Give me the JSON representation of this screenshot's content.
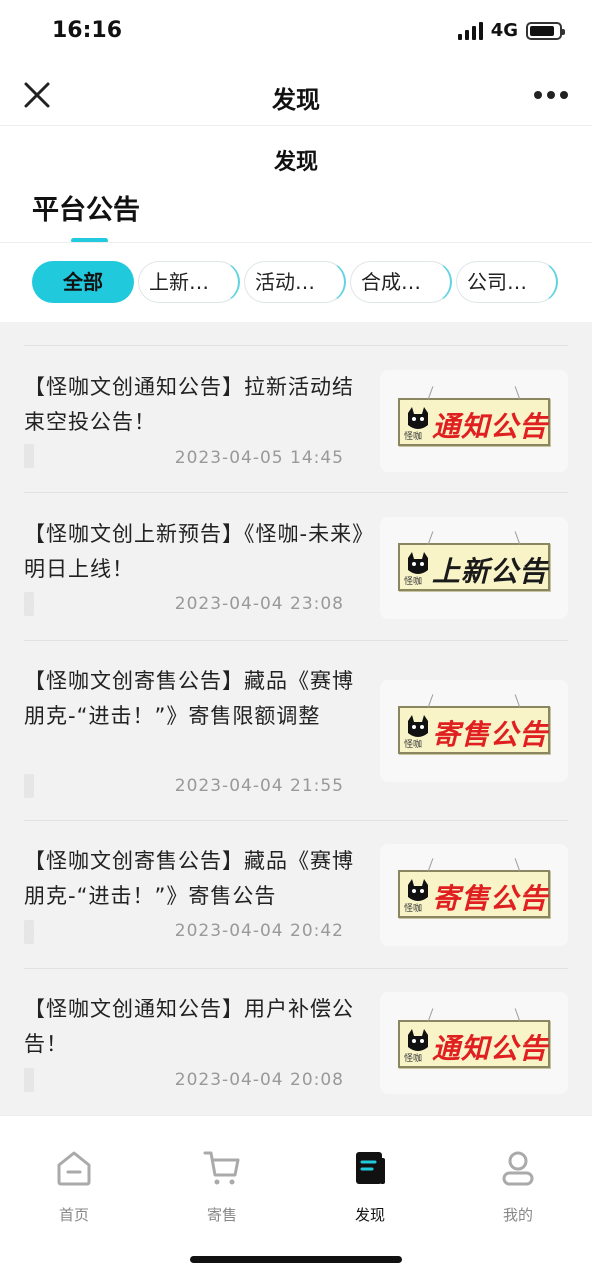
{
  "status_bar": {
    "time": "16:16",
    "network": "4G"
  },
  "nav": {
    "title": "发现"
  },
  "page": {
    "subtitle": "发现",
    "section_tab": "平台公告"
  },
  "filters": [
    "全部",
    "上新…",
    "活动…",
    "合成…",
    "公司…"
  ],
  "announcements": [
    {
      "title": "【怪咖文创通知公告】拉新活动结束空投公告！",
      "date": "2023-04-05 14:45",
      "thumb_text": "通知公告",
      "thumb_color": "#e02020",
      "thumb_logo_text": "怪咖"
    },
    {
      "title": "【怪咖文创上新预告】《怪咖-未来》明日上线！",
      "date": "2023-04-04 23:08",
      "thumb_text": "上新公告",
      "thumb_color": "#1a1a1a",
      "thumb_logo_text": "怪咖"
    },
    {
      "title": "【怪咖文创寄售公告】藏品《赛博朋克-“进击！”》寄售限额调整",
      "date": "2023-04-04 21:55",
      "thumb_text": "寄售公告",
      "thumb_color": "#e02020",
      "thumb_logo_text": "怪咖"
    },
    {
      "title": "【怪咖文创寄售公告】藏品《赛博朋克-“进击！”》寄售公告",
      "date": "2023-04-04 20:42",
      "thumb_text": "寄售公告",
      "thumb_color": "#e02020",
      "thumb_logo_text": "怪咖"
    },
    {
      "title": "【怪咖文创通知公告】用户补偿公告！",
      "date": "2023-04-04 20:08",
      "thumb_text": "通知公告",
      "thumb_color": "#e02020",
      "thumb_logo_text": "怪咖"
    }
  ],
  "tab_bar": [
    {
      "label": "首页",
      "icon": "home-icon",
      "active": false
    },
    {
      "label": "寄售",
      "icon": "cart-icon",
      "active": false
    },
    {
      "label": "发现",
      "icon": "discover-icon",
      "active": true
    },
    {
      "label": "我的",
      "icon": "profile-icon",
      "active": false
    }
  ],
  "colors": {
    "accent": "#21c9dc"
  }
}
